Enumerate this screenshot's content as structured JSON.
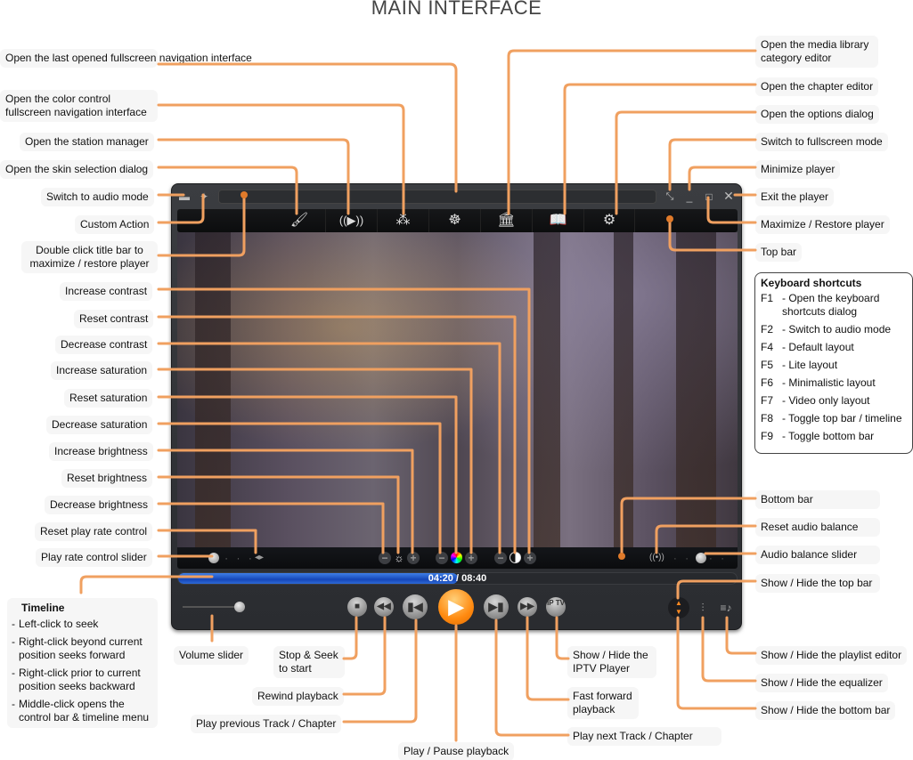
{
  "title": "MAIN INTERFACE",
  "player": {
    "time_current": "04:20",
    "time_total": "08:40",
    "time_display": "04:20 / 08:40",
    "timeline_progress": 0.5,
    "volume_level": 0.85,
    "play_rate_level": 0.0,
    "audio_balance_level": 0.5,
    "topbar_icons": [
      "brush-icon",
      "broadcast-icon",
      "circles-icon",
      "color-wheel-icon",
      "library-icon",
      "chapter-book-icon",
      "gear-icon"
    ],
    "iptv_label": "IP TV"
  },
  "labels_left": {
    "last_fullscreen": "Open the last opened fullscreen navigation interface",
    "color_fullscreen": "Open the color control fullscreen navigation interface",
    "station_manager": "Open the station manager",
    "skin_selection": "Open the skin selection dialog",
    "audio_mode": "Switch to audio mode",
    "custom_action": "Custom Action",
    "title_bar": "Double click title bar to maximize / restore player",
    "increase_contrast": "Increase contrast",
    "reset_contrast": "Reset contrast",
    "decrease_contrast": "Decrease contrast",
    "increase_saturation": "Increase saturation",
    "reset_saturation": "Reset saturation",
    "decrease_saturation": "Decrease saturation",
    "increase_brightness": "Increase brightness",
    "reset_brightness": "Reset brightness",
    "decrease_brightness": "Decrease brightness",
    "reset_play_rate": "Reset play rate control",
    "play_rate_slider": "Play rate control slider"
  },
  "labels_right": {
    "media_library": "Open the media library category editor",
    "chapter_editor": "Open the chapter editor",
    "options_dialog": "Open the options dialog",
    "fullscreen": "Switch to fullscreen mode",
    "minimize": "Minimize player",
    "exit": "Exit the player",
    "maximize": "Maximize / Restore player",
    "top_bar": "Top bar",
    "bottom_bar": "Bottom bar",
    "reset_balance": "Reset audio balance",
    "balance_slider": "Audio balance slider",
    "toggle_top_bar": "Show / Hide the top bar",
    "toggle_playlist": "Show / Hide the playlist editor",
    "toggle_equalizer": "Show / Hide the equalizer",
    "toggle_bottom_bar": "Show / Hide the bottom bar"
  },
  "labels_bottom": {
    "volume_slider": "Volume slider",
    "stop": "Stop & Seek to start",
    "rewind": "Rewind playback",
    "prev": "Play previous Track / Chapter",
    "play_pause": "Play / Pause playback",
    "next": "Play next Track / Chapter",
    "fast_forward": "Fast forward playback",
    "iptv": "Show / Hide the IPTV Player"
  },
  "keyboard_shortcuts": {
    "title": "Keyboard shortcuts",
    "items": [
      {
        "key": "F1",
        "desc": "- Open the keyboard shortcuts dialog"
      },
      {
        "key": "F2",
        "desc": "- Switch to audio mode"
      },
      {
        "key": "F4",
        "desc": "- Default layout"
      },
      {
        "key": "F5",
        "desc": "- Lite layout"
      },
      {
        "key": "F6",
        "desc": "- Minimalistic layout"
      },
      {
        "key": "F7",
        "desc": "- Video only layout"
      },
      {
        "key": "F8",
        "desc": "- Toggle top bar / timeline"
      },
      {
        "key": "F9",
        "desc": "- Toggle bottom bar"
      }
    ]
  },
  "timeline_help": {
    "title": "Timeline",
    "items": [
      "Left-click to seek",
      "Right-click beyond current position seeks forward",
      "Right-click prior to current position seeks backward",
      "Middle-click opens the control bar & timeline menu"
    ]
  },
  "colors": {
    "callout_line": "#f0a060",
    "callout_dot": "#e07a2a",
    "play_button": "#ff8a10",
    "timeline_fill": "#1546b8"
  }
}
